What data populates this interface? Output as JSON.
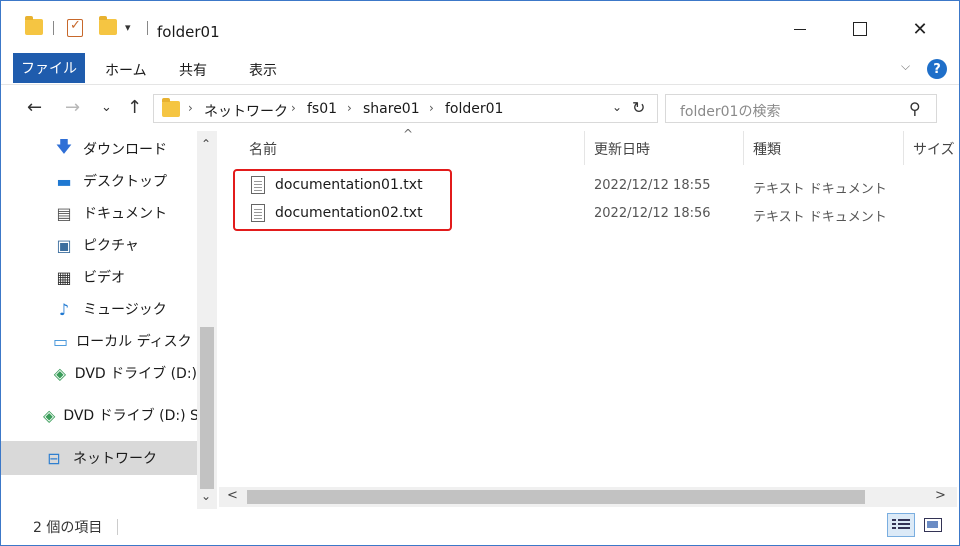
{
  "window": {
    "title": "folder01",
    "close_glyph": "✕"
  },
  "ribbon": {
    "file_tab": "ファイル",
    "tabs": [
      "ホーム",
      "共有",
      "表示"
    ],
    "collapse_glyph": "⌵",
    "help_glyph": "?"
  },
  "nav": {
    "back_glyph": "←",
    "forward_glyph": "→",
    "recent_glyph": "⌄",
    "up_glyph": "↑"
  },
  "address": {
    "crumbs": [
      "ネットワーク",
      "fs01",
      "share01",
      "folder01"
    ],
    "sep_glyph": "›",
    "dropdown_glyph": "⌄",
    "refresh_glyph": "↻"
  },
  "search": {
    "placeholder": "folder01の検索",
    "icon_glyph": "⚲"
  },
  "navpane": {
    "items": [
      {
        "label": "ダウンロード",
        "icon": "download-icon",
        "glyph": "🡇",
        "color": "#2f6fd6"
      },
      {
        "label": "デスクトップ",
        "icon": "desktop-icon",
        "glyph": "▬",
        "color": "#1f78d1"
      },
      {
        "label": "ドキュメント",
        "icon": "documents-icon",
        "glyph": "▤",
        "color": "#555555"
      },
      {
        "label": "ピクチャ",
        "icon": "pictures-icon",
        "glyph": "▣",
        "color": "#3c6e9e"
      },
      {
        "label": "ビデオ",
        "icon": "videos-icon",
        "glyph": "▦",
        "color": "#333333"
      },
      {
        "label": "ミュージック",
        "icon": "music-icon",
        "glyph": "♪",
        "color": "#1f78d1"
      },
      {
        "label": "ローカル ディスク (C",
        "icon": "local-disk-icon",
        "glyph": "▭",
        "color": "#3a8fd8"
      },
      {
        "label": "DVD ドライブ (D:) ",
        "icon": "dvd-drive-icon",
        "glyph": "◈",
        "color": "#3a9d5a"
      },
      {
        "label": "DVD ドライブ (D:) SS",
        "icon": "dvd-drive-icon",
        "glyph": "◈",
        "color": "#3a9d5a"
      },
      {
        "label": "ネットワーク",
        "icon": "network-icon",
        "glyph": "⊟",
        "color": "#2f7fd0"
      }
    ],
    "scroll_up_glyph": "⌃",
    "scroll_down_glyph": "⌄"
  },
  "filelist": {
    "columns": [
      "名前",
      "更新日時",
      "種類",
      "サイズ"
    ],
    "sort_glyph": "^",
    "rows": [
      {
        "name": "documentation01.txt",
        "date": "2022/12/12 18:55",
        "type": "テキスト ドキュメント"
      },
      {
        "name": "documentation02.txt",
        "date": "2022/12/12 18:56",
        "type": "テキスト ドキュメント"
      }
    ],
    "highlight_color": "#e21b1b",
    "scroll_left_glyph": "<",
    "scroll_right_glyph": ">"
  },
  "status": {
    "item_count": "2 個の項目"
  },
  "colors": {
    "file_tab": "#1f5cad",
    "accent": "#1f6fc9",
    "folder": "#f5c542"
  }
}
